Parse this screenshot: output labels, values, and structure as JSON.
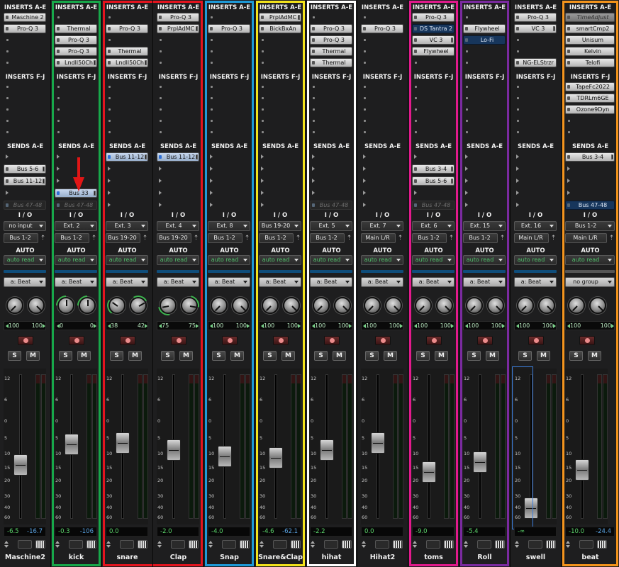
{
  "sections": {
    "inserts_ae": "INSERTS A-E",
    "inserts_fj": "INSERTS F-J",
    "sends_ae": "SENDS A-E",
    "io": "I / O",
    "auto": "AUTO"
  },
  "colors": {
    "kick": "#17a84a",
    "snare_clap": "#e4141e",
    "snap": "#1e9ad8",
    "snareclap": "#f3e31c",
    "hihat": "#ffffff",
    "toms": "#e21a8c",
    "roll": "#7b2aa0",
    "beat": "#f4941c",
    "arrow": "#e11616"
  },
  "strips": [
    {
      "name": "Maschine2",
      "inserts": [
        "Maschine 2",
        "Pro-Q 3",
        "",
        "",
        ""
      ],
      "inserts2": [
        "",
        "",
        "",
        "",
        ""
      ],
      "sends": [
        "",
        "Bus 5-6",
        "Bus 11-12",
        "",
        "Bus 47-48"
      ],
      "sends_style": [
        "",
        "send",
        "send",
        "",
        "inactive"
      ],
      "input": "no input",
      "output": "Bus 1-2",
      "auto": "auto read",
      "group": "a: Beat",
      "pan_l": "100",
      "pan_r": "100",
      "vol": "-6.5",
      "peak": "-16.7",
      "fader_level": 0.36,
      "knob_l": -135,
      "knob_r": 135
    },
    {
      "name": "kick",
      "inserts": [
        "",
        "Thermal",
        "Pro-Q 3",
        "Pro-Q 3",
        "Lndll50Ch"
      ],
      "inserts2": [
        "",
        "",
        "",
        "",
        ""
      ],
      "sends": [
        "",
        "",
        "",
        "Bus 33",
        "Bus 47-48"
      ],
      "sends_style": [
        "",
        "",
        "",
        "blue",
        "ghost"
      ],
      "input": "Ext. 2",
      "output": "Bus 1-2",
      "auto": "auto read",
      "group": "a: Beat",
      "pan_l": "0",
      "pan_r": "0",
      "vol": "-0.3",
      "peak": "-106",
      "fader_level": 0.53,
      "knob_l": 0,
      "knob_r": 0
    },
    {
      "name": "snare",
      "inserts": [
        "",
        "Pro-Q 3",
        "",
        "Thermal",
        "Lndll50Ch"
      ],
      "inserts2": [
        "",
        "",
        "",
        "",
        ""
      ],
      "sends": [
        "Bus 11-12",
        "",
        "",
        "",
        ""
      ],
      "sends_style": [
        "blue",
        "",
        "",
        "",
        ""
      ],
      "input": "Ext. 3",
      "output": "Bus 19-20",
      "auto": "auto read",
      "group": "a: Beat",
      "pan_l": "38",
      "pan_r": "42",
      "vol": "0.0",
      "peak": "",
      "fader_level": 0.54,
      "knob_l": -55,
      "knob_r": 60
    },
    {
      "name": "Clap",
      "inserts": [
        "Pro-Q 3",
        "PrplAdMC",
        "",
        "",
        ""
      ],
      "inserts2": [
        "",
        "",
        "",
        "",
        ""
      ],
      "sends": [
        "Bus 11-12",
        "",
        "",
        "",
        ""
      ],
      "sends_style": [
        "blue",
        "",
        "",
        "",
        ""
      ],
      "input": "Ext. 4",
      "output": "Bus 19-20",
      "auto": "auto read",
      "group": "a: Beat",
      "pan_l": "75",
      "pan_r": "75",
      "vol": "-2.0",
      "peak": "",
      "fader_level": 0.48,
      "knob_l": -100,
      "knob_r": 100
    },
    {
      "name": "Snap",
      "inserts": [
        "",
        "Pro-Q 3",
        "",
        "",
        ""
      ],
      "inserts2": [
        "",
        "",
        "",
        "",
        ""
      ],
      "sends": [
        "",
        "",
        "",
        "",
        ""
      ],
      "sends_style": [
        "",
        "",
        "",
        "",
        ""
      ],
      "input": "Ext. 8",
      "output": "Bus 1-2",
      "auto": "auto read",
      "group": "a: Beat",
      "pan_l": "100",
      "pan_r": "100",
      "vol": "-4.0",
      "peak": "",
      "fader_level": 0.43,
      "knob_l": -135,
      "knob_r": 135
    },
    {
      "name": "Snare&Clap",
      "inserts": [
        "PrplAdMC",
        "BickBxAn",
        "",
        "",
        ""
      ],
      "inserts2": [
        "",
        "",
        "",
        "",
        ""
      ],
      "sends": [
        "",
        "",
        "",
        "",
        ""
      ],
      "sends_style": [
        "",
        "",
        "",
        "",
        ""
      ],
      "input": "Bus 19-20",
      "output": "Bus 1-2",
      "auto": "auto read",
      "group": "a: Beat",
      "pan_l": "100",
      "pan_r": "100",
      "vol": "-4.6",
      "peak": "-62.1",
      "fader_level": 0.42,
      "knob_l": -135,
      "knob_r": 135
    },
    {
      "name": "hihat",
      "inserts": [
        "",
        "Pro-Q 3",
        "Pro-Q 3",
        "Thermal",
        "Thermal"
      ],
      "inserts2": [
        "",
        "",
        "",
        "",
        ""
      ],
      "sends": [
        "",
        "",
        "",
        "",
        "Bus 47-48"
      ],
      "sends_style": [
        "",
        "",
        "",
        "",
        "inactive"
      ],
      "input": "Ext. 5",
      "output": "Bus 1-2",
      "auto": "auto read",
      "group": "a: Beat",
      "pan_l": "100",
      "pan_r": "100",
      "vol": "-2.2",
      "peak": "",
      "fader_level": 0.48,
      "knob_l": -135,
      "knob_r": 135
    },
    {
      "name": "Hihat2",
      "inserts": [
        "",
        "Pro-Q 3",
        "",
        "",
        ""
      ],
      "inserts2": [
        "",
        "",
        "",
        "",
        ""
      ],
      "sends": [
        "",
        "",
        "",
        "",
        ""
      ],
      "sends_style": [
        "",
        "",
        "",
        "",
        ""
      ],
      "input": "Ext. 7",
      "output": "Main L/R",
      "auto": "auto read",
      "group": "a: Beat",
      "pan_l": "100",
      "pan_r": "100",
      "vol": "0.0",
      "peak": "",
      "fader_level": 0.54,
      "knob_l": -135,
      "knob_r": 135
    },
    {
      "name": "toms",
      "inserts": [
        "Pro-Q 3",
        "DS Tantra 2",
        "VC 3",
        "Flywheel",
        ""
      ],
      "inserts2": [
        "",
        "",
        "",
        "",
        ""
      ],
      "sends": [
        "",
        "Bus 3-4",
        "Bus 5-6",
        "",
        "Bus 47-48"
      ],
      "sends_style": [
        "",
        "send",
        "send",
        "",
        "inactive"
      ],
      "input": "Ext. 6",
      "output": "Bus 1-2",
      "auto": "auto read",
      "group": "a: Beat",
      "pan_l": "100",
      "pan_r": "100",
      "vol": "-9.0",
      "peak": "",
      "fader_level": 0.3,
      "knob_l": -135,
      "knob_r": 135,
      "sel": [
        1
      ]
    },
    {
      "name": "Roll",
      "inserts": [
        "",
        "Flywheel",
        "Lo-Fi",
        "",
        ""
      ],
      "inserts2": [
        "",
        "",
        "",
        "",
        ""
      ],
      "sends": [
        "",
        "",
        "",
        "",
        ""
      ],
      "sends_style": [
        "",
        "",
        "",
        "",
        ""
      ],
      "input": "Ext. 15",
      "output": "Bus 1-2",
      "auto": "auto read",
      "group": "a: Beat",
      "pan_l": "100",
      "pan_r": "100",
      "vol": "-5.4",
      "peak": "",
      "fader_level": 0.38,
      "knob_l": -135,
      "knob_r": 135,
      "sel": [
        2
      ]
    },
    {
      "name": "swell",
      "inserts": [
        "Pro-Q 3",
        "VC 3",
        "",
        "",
        "NG-ELStrzr"
      ],
      "inserts2": [
        "",
        "",
        "",
        "",
        ""
      ],
      "sends": [
        "",
        "",
        "",
        "",
        ""
      ],
      "sends_style": [
        "",
        "",
        "",
        "",
        ""
      ],
      "input": "Ext. 16",
      "output": "Main L/R",
      "auto": "auto read",
      "group": "a: Beat",
      "pan_l": "100",
      "pan_r": "100",
      "vol": "-∞",
      "peak": "",
      "fader_level": 0.0,
      "knob_l": -135,
      "knob_r": 135,
      "swell_sel": true
    },
    {
      "name": "beat",
      "inserts": [
        "TimeAdjust",
        "smartCmp2",
        "Unisum",
        "Kelvin",
        "Telofi"
      ],
      "inserts2": [
        "TapeFc2022",
        "TDRLm6GE",
        "Ozone9Dyn",
        "",
        ""
      ],
      "sends": [
        "Bus 3-4",
        "",
        "",
        "",
        "Bus 47-48"
      ],
      "sends_style": [
        "send",
        "",
        "",
        "",
        "sel"
      ],
      "input": "Bus 1-2",
      "output": "Main L/R",
      "auto": "auto read",
      "group": "no group",
      "pan_l": "100",
      "pan_r": "100",
      "vol": "-10.0",
      "peak": "-24.4",
      "fader_level": 0.32,
      "knob_l": -135,
      "knob_r": 135,
      "inactive0": true
    }
  ],
  "scale": [
    "12",
    "6",
    "0",
    "5",
    "10",
    "15",
    "20",
    "30",
    "40",
    "60"
  ]
}
